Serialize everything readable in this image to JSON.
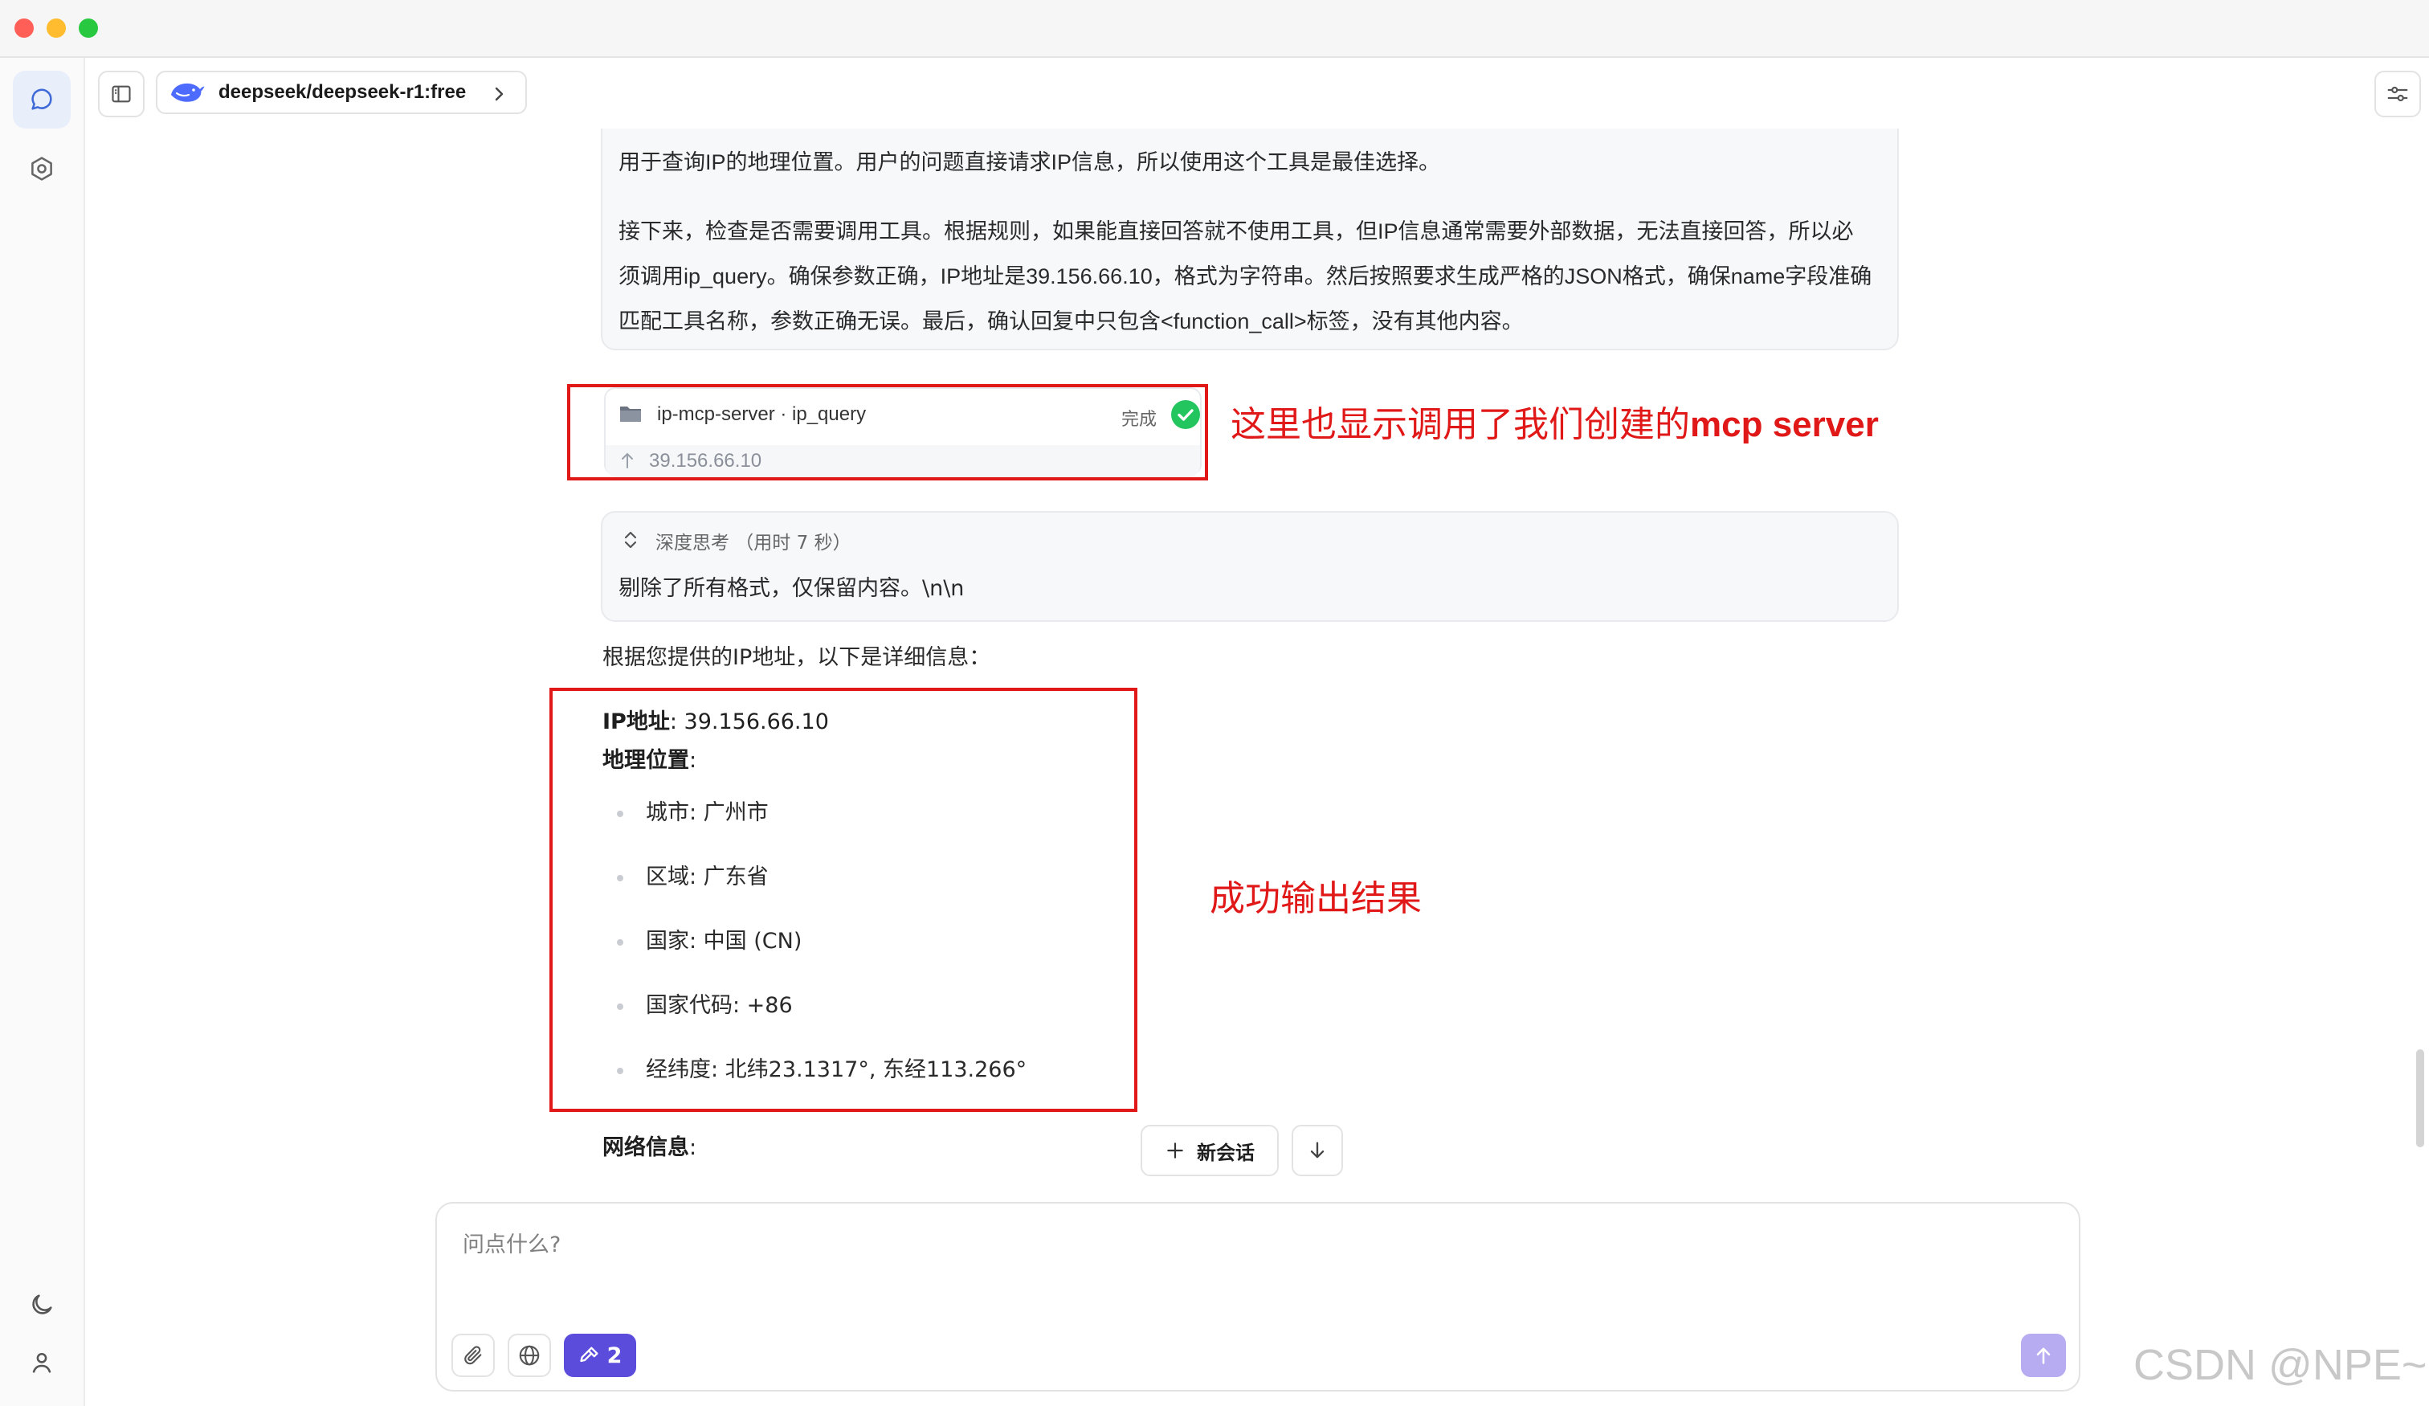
{
  "header": {
    "model_name": "deepseek/deepseek-r1:free"
  },
  "thinking": {
    "paragraphs": [
      "用于查询IP的地理位置。用户的问题直接请求IP信息，所以使用这个工具是最佳选择。",
      "接下来，检查是否需要调用工具。根据规则，如果能直接回答就不使用工具，但IP信息通常需要外部数据，无法直接回答，所以必须调用ip_query。确保参数正确，IP地址是39.156.66.10，格式为字符串。然后按照要求生成严格的JSON格式，确保name字段准确匹配工具名称，参数正确无误。最后，确认回复中只包含<function_call>标签，没有其他内容。"
    ]
  },
  "tool_call": {
    "name": "ip-mcp-server · ip_query",
    "status": "完成",
    "argument": "39.156.66.10"
  },
  "annotations": {
    "tool_note_prefix": "这里也显示调用了我们创建的",
    "tool_note_bold": "mcp server",
    "result_note": "成功输出结果"
  },
  "deep_thinking": {
    "title": "深度思考 （用时 7 秒）",
    "text": "剔除了所有格式，仅保留内容。\\n\\n"
  },
  "answer": {
    "intro": "根据您提供的IP地址，以下是详细信息：",
    "ip_label": "IP地址",
    "ip_value": ": 39.156.66.10",
    "geo_label": "地理位置",
    "geo_suffix": ":",
    "geo_items": [
      "城市: 广州市",
      "区域: 广东省",
      "国家: 中国 (CN)",
      "国家代码: +86",
      "经纬度: 北纬23.1317°, 东经113.266°"
    ],
    "network_label": "网络信息",
    "network_suffix": ":"
  },
  "floating": {
    "new_chat_label": "新会话"
  },
  "composer": {
    "placeholder": "问点什么?",
    "tools_count": "2"
  },
  "watermark": "CSDN @NPE~",
  "colors": {
    "annotation_red": "#e01818",
    "accent_purple": "#5b4cdb",
    "success_green": "#22c55e"
  },
  "icons": {
    "rail": [
      "chat-bubble-icon",
      "gear-hexagon-icon",
      "moon-icon",
      "user-icon"
    ],
    "toolbar": [
      "sidebar-toggle-icon",
      "deepseek-whale-icon",
      "chevron-right-icon",
      "sliders-icon"
    ],
    "composer": [
      "paperclip-icon",
      "globe-icon",
      "hammer-icon",
      "arrow-up-icon"
    ]
  }
}
